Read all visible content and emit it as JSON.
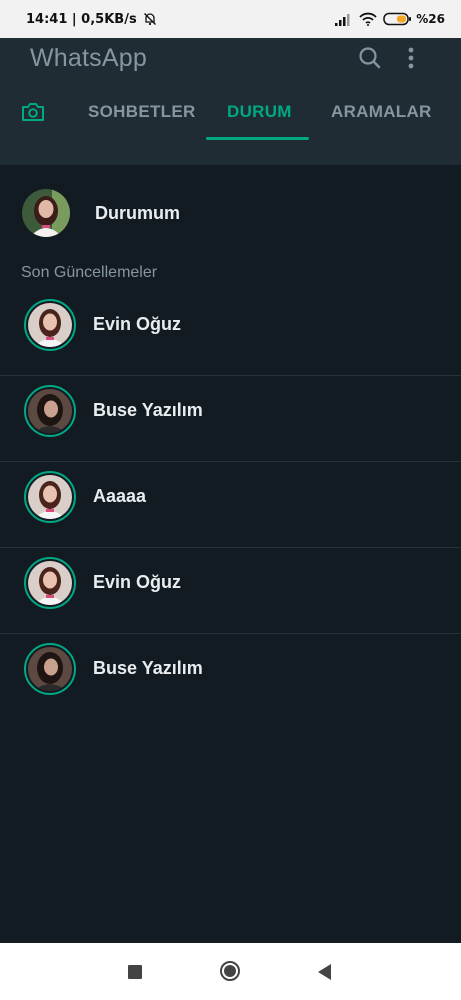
{
  "statusbar": {
    "time_speed": "14:41 | 0,5KB/s",
    "battery": "%26",
    "icons": [
      "mute-bell-icon",
      "signal-icon",
      "wifi-icon",
      "battery-icon"
    ]
  },
  "appbar": {
    "title": "WhatsApp",
    "icons": [
      "search-icon",
      "more-vert-icon"
    ],
    "tabs": [
      {
        "label": "SOHBETLER"
      },
      {
        "label": "DURUM",
        "active": true
      },
      {
        "label": "ARAMALAR"
      }
    ],
    "camera_icon": "camera-icon"
  },
  "my_status": {
    "label": "Durumum"
  },
  "section_label": "Son Güncellemeler",
  "status_list": [
    {
      "name": "Evin Oğuz"
    },
    {
      "name": "Buse Yazılım"
    },
    {
      "name": "Aaaaa"
    },
    {
      "name": "Evin Oğuz"
    },
    {
      "name": "Buse Yazılım"
    }
  ],
  "colors": {
    "accent": "#00a884",
    "background": "#121b22",
    "appbar": "#1f2c34",
    "muted_text": "#8696a0"
  },
  "navbar": {
    "icons": [
      "recent-apps-icon",
      "home-icon",
      "back-icon"
    ]
  }
}
